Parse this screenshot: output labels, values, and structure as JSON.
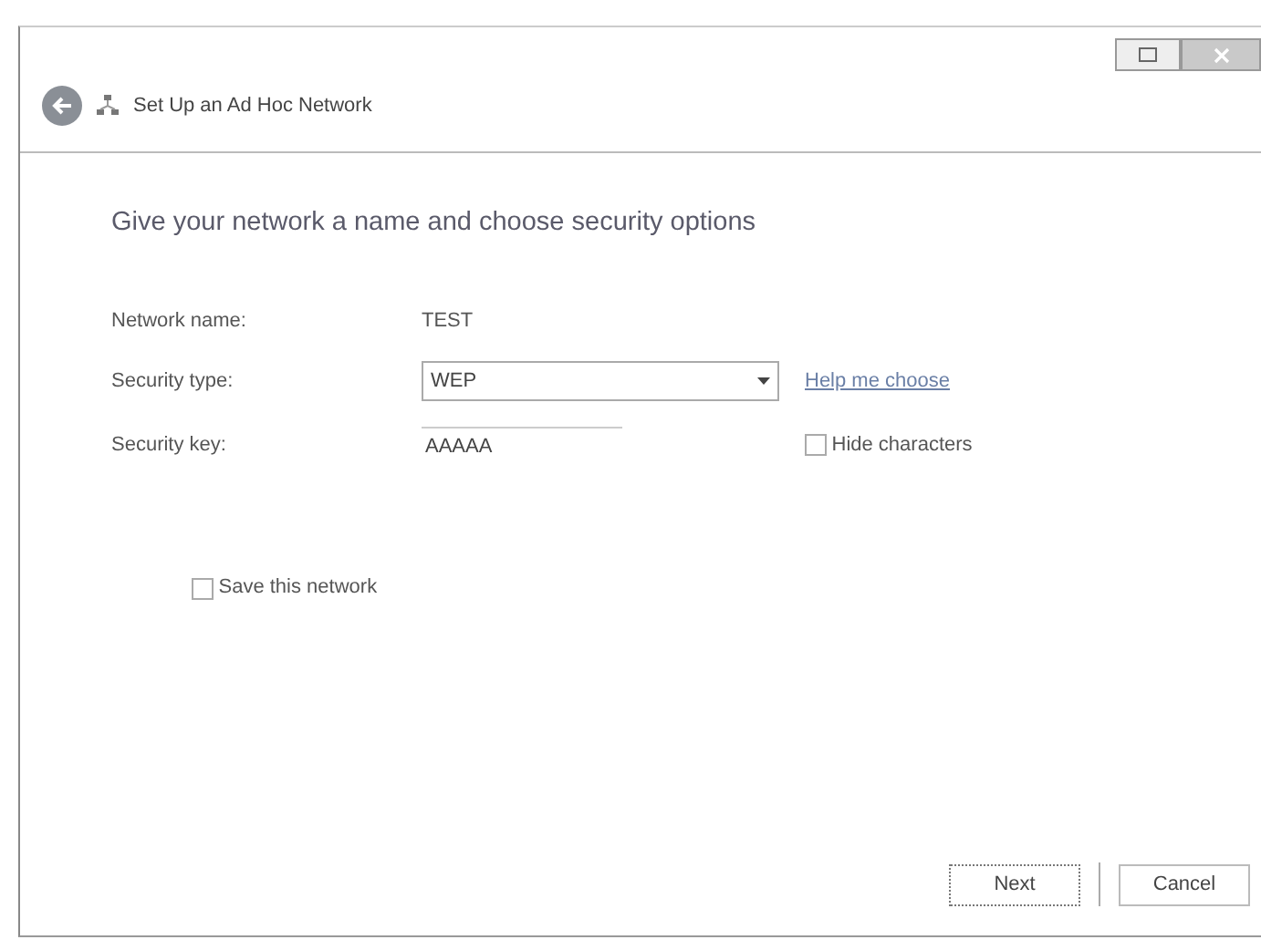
{
  "window": {
    "title": "Set Up an Ad Hoc Network"
  },
  "heading": "Give your network a name and choose security options",
  "fields": [
    {
      "kind": "text",
      "label": "Network name:",
      "value": "TEST"
    },
    {
      "kind": "select",
      "label": "Security type:",
      "value": "WEP",
      "link": "Help me choose"
    },
    {
      "kind": "input",
      "label": "Security key:",
      "value": "AAAAA",
      "option": {
        "label": "Hide characters",
        "checked": false
      }
    }
  ],
  "save": {
    "label": "Save this network",
    "checked": false
  },
  "buttons": [
    {
      "label": "Next",
      "default": true
    },
    {
      "label": "Cancel",
      "default": false
    }
  ]
}
